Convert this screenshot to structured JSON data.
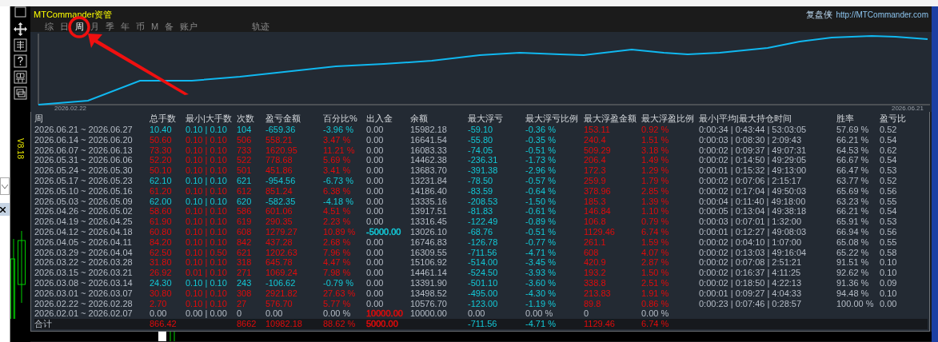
{
  "window": {
    "title": "MTCommander资管",
    "brand": "复盘侠",
    "url": "http://MTCommander.com",
    "version": "V8.18"
  },
  "tabs": [
    {
      "label": "综",
      "selected": false
    },
    {
      "label": "日",
      "selected": false
    },
    {
      "label": "周",
      "selected": true
    },
    {
      "label": "月",
      "selected": false
    },
    {
      "label": "季",
      "selected": false
    },
    {
      "label": "年",
      "selected": false
    },
    {
      "label": "币",
      "selected": false
    },
    {
      "label": "M",
      "selected": false
    },
    {
      "label": "备",
      "selected": false
    },
    {
      "label": "账户",
      "selected": false
    }
  ],
  "trail_tab": {
    "label": "轨迹",
    "selected": false
  },
  "chart": {
    "start_label": "2026.02.22",
    "end_label": "2026.06.21"
  },
  "table": {
    "columns": [
      "周",
      "总手数",
      "最小|大手数",
      "次数",
      "盈亏金额",
      "百分比%",
      "出入金",
      "余额",
      "最大浮亏",
      "最大浮亏比例",
      "最大浮盈金额",
      "最大浮盈比例",
      "最小|平均|最大持仓时间",
      "胜率",
      "盈亏比"
    ],
    "rows": [
      {
        "kind": "loss",
        "period": "2026.06.21 ~ 2026.06.27",
        "lots": "10.40",
        "lot_range": "0.10 | 0.10",
        "trades": "104",
        "pnl": "-659.36",
        "pct": "-3.96 %",
        "deposit": "0.00",
        "balance": "15982.18",
        "max_dd": "-59.10",
        "max_dd_pct": "-0.36 %",
        "max_fp": "153.11",
        "max_fp_pct": "0.92 %",
        "hold_times": "0:00:34 | 0:43:44 | 53:03:05",
        "win_rate": "57.69 %",
        "pl_ratio": "0.52"
      },
      {
        "kind": "profit",
        "period": "2026.06.14 ~ 2026.06.20",
        "lots": "50.60",
        "lot_range": "0.10 | 0.10",
        "trades": "506",
        "pnl": "558.21",
        "pct": "3.47 %",
        "deposit": "0.00",
        "balance": "16641.54",
        "max_dd": "-55.80",
        "max_dd_pct": "-0.35 %",
        "max_fp": "240.4",
        "max_fp_pct": "1.51 %",
        "hold_times": "0:00:03 | 0:08:30 | 2:09:43",
        "win_rate": "66.21 %",
        "pl_ratio": "0.54"
      },
      {
        "kind": "profit",
        "period": "2026.06.07 ~ 2026.06.13",
        "lots": "73.30",
        "lot_range": "0.10 | 0.10",
        "trades": "733",
        "pnl": "1620.95",
        "pct": "11.21 %",
        "deposit": "0.00",
        "balance": "16083.33",
        "max_dd": "-74.05",
        "max_dd_pct": "-0.51 %",
        "max_fp": "509.29",
        "max_fp_pct": "3.18 %",
        "hold_times": "0:00:02 | 0:09:37 | 49:07:31",
        "win_rate": "64.53 %",
        "pl_ratio": "0.62"
      },
      {
        "kind": "profit",
        "period": "2026.05.31 ~ 2026.06.06",
        "lots": "52.20",
        "lot_range": "0.10 | 0.10",
        "trades": "522",
        "pnl": "778.68",
        "pct": "5.69 %",
        "deposit": "0.00",
        "balance": "14462.38",
        "max_dd": "-236.31",
        "max_dd_pct": "-1.73 %",
        "max_fp": "206.4",
        "max_fp_pct": "1.49 %",
        "hold_times": "0:00:02 | 0:14:50 | 49:29:05",
        "win_rate": "66.67 %",
        "pl_ratio": "0.54"
      },
      {
        "kind": "profit",
        "period": "2026.05.24 ~ 2026.05.30",
        "lots": "50.10",
        "lot_range": "0.10 | 0.10",
        "trades": "501",
        "pnl": "451.86",
        "pct": "3.41 %",
        "deposit": "0.00",
        "balance": "13683.70",
        "max_dd": "-391.38",
        "max_dd_pct": "-2.96 %",
        "max_fp": "172.3",
        "max_fp_pct": "1.29 %",
        "hold_times": "0:00:01 | 0:15:32 | 49:13:00",
        "win_rate": "66.47 %",
        "pl_ratio": "0.53"
      },
      {
        "kind": "loss",
        "period": "2026.05.17 ~ 2026.05.23",
        "lots": "62.10",
        "lot_range": "0.10 | 0.10",
        "trades": "621",
        "pnl": "-954.56",
        "pct": "-6.73 %",
        "deposit": "0.00",
        "balance": "13231.84",
        "max_dd": "-78.50",
        "max_dd_pct": "-0.57 %",
        "max_fp": "259.9",
        "max_fp_pct": "1.79 %",
        "hold_times": "0:00:02 | 0:07:06 | 2:15:17",
        "win_rate": "63.77 %",
        "pl_ratio": "0.52"
      },
      {
        "kind": "profit",
        "period": "2026.05.10 ~ 2026.05.16",
        "lots": "61.20",
        "lot_range": "0.10 | 0.10",
        "trades": "612",
        "pnl": "851.24",
        "pct": "6.38 %",
        "deposit": "0.00",
        "balance": "14186.40",
        "max_dd": "-83.59",
        "max_dd_pct": "-0.64 %",
        "max_fp": "378.96",
        "max_fp_pct": "2.85 %",
        "hold_times": "0:00:02 | 0:17:04 | 49:50:03",
        "win_rate": "65.69 %",
        "pl_ratio": "0.56"
      },
      {
        "kind": "loss",
        "period": "2026.05.03 ~ 2026.05.09",
        "lots": "62.00",
        "lot_range": "0.10 | 0.10",
        "trades": "620",
        "pnl": "-582.35",
        "pct": "-4.18 %",
        "deposit": "0.00",
        "balance": "13335.16",
        "max_dd": "-208.53",
        "max_dd_pct": "-1.50 %",
        "max_fp": "185.3",
        "max_fp_pct": "1.39 %",
        "hold_times": "0:00:04 | 0:11:40 | 49:18:00",
        "win_rate": "63.23 %",
        "pl_ratio": "0.55"
      },
      {
        "kind": "profit",
        "period": "2026.04.26 ~ 2026.05.02",
        "lots": "58.60",
        "lot_range": "0.10 | 0.10",
        "trades": "586",
        "pnl": "601.06",
        "pct": "4.51 %",
        "deposit": "0.00",
        "balance": "13917.51",
        "max_dd": "-81.83",
        "max_dd_pct": "-0.61 %",
        "max_fp": "146.84",
        "max_fp_pct": "1.10 %",
        "hold_times": "0:00:05 | 0:13:04 | 49:38:18",
        "win_rate": "66.21 %",
        "pl_ratio": "0.54"
      },
      {
        "kind": "profit",
        "period": "2026.04.19 ~ 2026.04.25",
        "lots": "61.90",
        "lot_range": "0.10 | 0.10",
        "trades": "619",
        "pnl": "290.35",
        "pct": "2.23 %",
        "deposit": "0.00",
        "balance": "13316.45",
        "max_dd": "-122.49",
        "max_dd_pct": "-0.89 %",
        "max_fp": "106.8",
        "max_fp_pct": "0.79 %",
        "hold_times": "0:00:03 | 0:07:01 | 1:32:00",
        "win_rate": "65.91 %",
        "pl_ratio": "0.53"
      },
      {
        "kind": "profit",
        "period": "2026.04.12 ~ 2026.04.18",
        "lots": "60.80",
        "lot_range": "0.10 | 0.10",
        "trades": "608",
        "pnl": "1279.27",
        "pct": "10.89 %",
        "deposit": {
          "value": "-5000.00",
          "color": "#13c8d6"
        },
        "balance": "13026.10",
        "max_dd": "-68.76",
        "max_dd_pct": "-0.51 %",
        "max_fp": "1129.46",
        "max_fp_pct": "6.74 %",
        "hold_times": "0:00:01 | 0:12:27 | 49:08:03",
        "win_rate": "66.94 %",
        "pl_ratio": "0.56"
      },
      {
        "kind": "profit",
        "period": "2026.04.05 ~ 2026.04.11",
        "lots": "84.20",
        "lot_range": "0.10 | 0.10",
        "trades": "842",
        "pnl": "437.28",
        "pct": "2.68 %",
        "deposit": "0.00",
        "balance": "16746.83",
        "max_dd": "-126.78",
        "max_dd_pct": "-0.77 %",
        "max_fp": "261.1",
        "max_fp_pct": "1.59 %",
        "hold_times": "0:00:02 | 0:04:10 | 1:07:00",
        "win_rate": "65.08 %",
        "pl_ratio": "0.55"
      },
      {
        "kind": "profit",
        "period": "2026.03.29 ~ 2026.04.04",
        "lots": "62.50",
        "lot_range": "0.10 | 0.50",
        "trades": "621",
        "pnl": "1202.63",
        "pct": "7.96 %",
        "deposit": "0.00",
        "balance": "16309.55",
        "max_dd": "-711.56",
        "max_dd_pct": "-4.71 %",
        "max_fp": "608",
        "max_fp_pct": "4.07 %",
        "hold_times": "0:00:02 | 0:13:03 | 49:16:04",
        "win_rate": "65.22 %",
        "pl_ratio": "0.58"
      },
      {
        "kind": "profit",
        "period": "2026.03.22 ~ 2026.03.28",
        "lots": "31.80",
        "lot_range": "0.10 | 0.10",
        "trades": "318",
        "pnl": "645.78",
        "pct": "4.47 %",
        "deposit": "0.00",
        "balance": "15106.92",
        "max_dd": "-514.00",
        "max_dd_pct": "-3.45 %",
        "max_fp": "420.9",
        "max_fp_pct": "2.87 %",
        "hold_times": "0:00:02 | 0:07:08 | 2:51:21",
        "win_rate": "91.51 %",
        "pl_ratio": "0.10"
      },
      {
        "kind": "profit",
        "period": "2026.03.15 ~ 2026.03.21",
        "lots": "26.92",
        "lot_range": "0.01 | 0.10",
        "trades": "271",
        "pnl": "1069.24",
        "pct": "7.98 %",
        "deposit": "0.00",
        "balance": "14461.14",
        "max_dd": "-524.50",
        "max_dd_pct": "-3.93 %",
        "max_fp": "193.2",
        "max_fp_pct": "1.50 %",
        "hold_times": "0:00:02 | 0:16:37 | 4:11:25",
        "win_rate": "92.62 %",
        "pl_ratio": "0.10"
      },
      {
        "kind": "loss",
        "period": "2026.03.08 ~ 2026.03.14",
        "lots": "24.30",
        "lot_range": "0.10 | 0.10",
        "trades": "243",
        "pnl": "-106.62",
        "pct": "-0.79 %",
        "deposit": "0.00",
        "balance": "13391.90",
        "max_dd": "-501.10",
        "max_dd_pct": "-3.60 %",
        "max_fp": "338.8",
        "max_fp_pct": "2.51 %",
        "hold_times": "0:00:02 | 0:18:50 | 4:22:13",
        "win_rate": "91.36 %",
        "pl_ratio": "0.09"
      },
      {
        "kind": "profit",
        "period": "2026.03.01 ~ 2026.03.07",
        "lots": "30.80",
        "lot_range": "0.10 | 0.10",
        "trades": "308",
        "pnl": "2921.82",
        "pct": "27.63 %",
        "deposit": "0.00",
        "balance": "13498.52",
        "max_dd": "-495.00",
        "max_dd_pct": "-4.30 %",
        "max_fp": "213.83",
        "max_fp_pct": "1.91 %",
        "hold_times": "0:00:01 | 0:09:27 | 4:04:33",
        "win_rate": "94.48 %",
        "pl_ratio": "0.10"
      },
      {
        "kind": "profit",
        "period": "2026.02.22 ~ 2026.02.28",
        "lots": "2.70",
        "lot_range": "0.10 | 0.10",
        "trades": "27",
        "pnl": "576.70",
        "pct": "5.77 %",
        "deposit": "0.00",
        "balance": "10576.70",
        "max_dd": "-123.00",
        "max_dd_pct": "-1.19 %",
        "max_fp": "89.8",
        "max_fp_pct": "0.86 %",
        "hold_times": "0:00:23 | 0:07:46 | 0:28:57",
        "win_rate": "100.00 %",
        "pl_ratio": "0.00"
      },
      {
        "kind": "flat",
        "period": "2026.02.01 ~ 2026.02.07",
        "lots": "0.00",
        "lot_range": "0.00 | 0.00",
        "trades": "0",
        "pnl": "0.00",
        "pct": "0.00 %",
        "deposit": {
          "value": "10000.00",
          "color": "#e00b0b"
        },
        "balance": "10000.00",
        "max_dd": "0.00",
        "max_dd_pct": "0.00 %",
        "max_fp": "0",
        "max_fp_pct": "0.00 %"
      }
    ],
    "total": {
      "kind": "profit",
      "period": "合计",
      "lots": "866.42",
      "trades": "8662",
      "pnl": "10982.18",
      "pct": "88.62 %",
      "deposit": {
        "value": "5000.00",
        "color": "#e00b0b"
      },
      "max_dd": "-711.56",
      "max_dd_pct": "-4.71 %",
      "max_fp": "1129.46",
      "max_fp_pct": "6.74 %"
    }
  }
}
